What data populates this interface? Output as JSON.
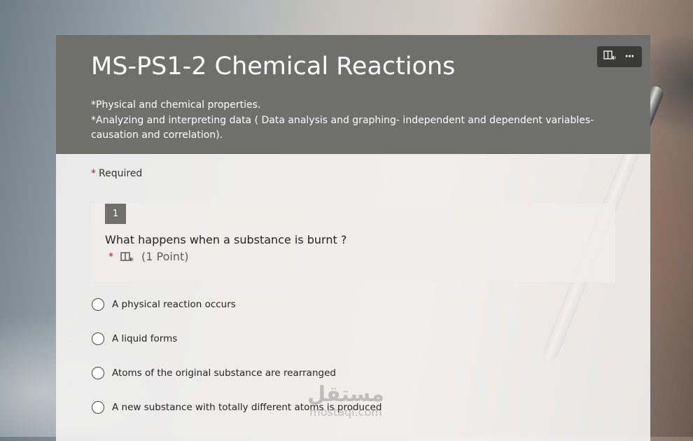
{
  "form": {
    "title": "MS-PS1-2 Chemical Reactions",
    "description_lines": [
      "*Physical and chemical properties.",
      "*Analyzing and interpreting data ( Data analysis and graphing- independent and dependent variables- causation and correlation)."
    ],
    "toolbar": {
      "immersive_reader_icon": "immersive-reader-icon",
      "more_icon": "more-options-icon",
      "more_glyph": "···"
    },
    "required_star": "*",
    "required_label": "Required",
    "colors": {
      "header": "#6f706c",
      "required_star": "#a4262c",
      "toolbar": "#3a3a39"
    }
  },
  "question": {
    "number": "1",
    "text": "What happens when a substance is burnt ?",
    "required_star": "*",
    "points": "(1 Point)",
    "options": [
      "A physical reaction occurs",
      "A liquid forms",
      "Atoms of the original substance are rearranged",
      "A new substance with totally different atoms is produced"
    ]
  },
  "watermark": {
    "arabic": "مستقل",
    "latin": "mostaql.com"
  }
}
